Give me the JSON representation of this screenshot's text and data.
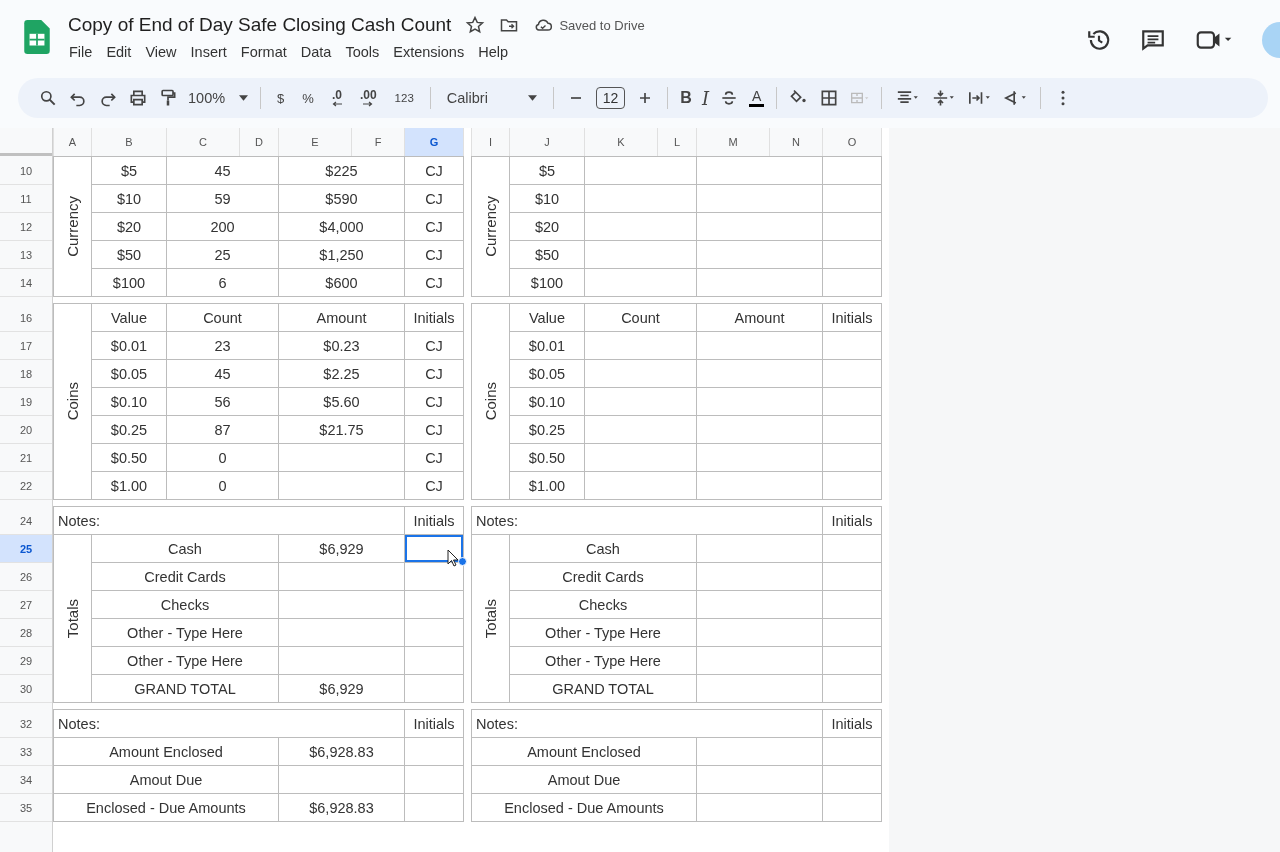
{
  "document": {
    "title": "Copy of End of Day Safe Closing Cash Count",
    "save_status": "Saved to Drive"
  },
  "menu": [
    "File",
    "Edit",
    "View",
    "Insert",
    "Format",
    "Data",
    "Tools",
    "Extensions",
    "Help"
  ],
  "toolbar": {
    "zoom": "100%",
    "currency": "$",
    "percent": "%",
    "decrease_decimals": ".0",
    "increase_decimals": ".00",
    "number_format": "123",
    "font": "Calibri",
    "font_size": "12",
    "bold": "B",
    "italic": "I",
    "text_color": "A"
  },
  "column_headers": [
    [
      {
        "label": "A",
        "selected": false
      },
      {
        "label": "B",
        "selected": false
      },
      {
        "label": "C",
        "selected": false
      },
      {
        "label": "D",
        "selected": false
      },
      {
        "label": "E",
        "selected": false
      },
      {
        "label": "F",
        "selected": false
      },
      {
        "label": "G",
        "selected": true
      }
    ],
    [
      {
        "label": "I",
        "selected": false
      },
      {
        "label": "J",
        "selected": false
      },
      {
        "label": "K",
        "selected": false
      },
      {
        "label": "L",
        "selected": false
      },
      {
        "label": "M",
        "selected": false
      },
      {
        "label": "N",
        "selected": false
      },
      {
        "label": "O",
        "selected": false
      }
    ]
  ],
  "row_groups": [
    [
      {
        "number": "10",
        "selected": false
      },
      {
        "number": "11",
        "selected": false
      },
      {
        "number": "12",
        "selected": false
      },
      {
        "number": "13",
        "selected": false
      },
      {
        "number": "14",
        "selected": false
      }
    ],
    [
      {
        "number": "16",
        "selected": false
      },
      {
        "number": "17",
        "selected": false
      },
      {
        "number": "18",
        "selected": false
      },
      {
        "number": "19",
        "selected": false
      },
      {
        "number": "20",
        "selected": false
      },
      {
        "number": "21",
        "selected": false
      },
      {
        "number": "22",
        "selected": false
      }
    ],
    [
      {
        "number": "24",
        "selected": false
      },
      {
        "number": "25",
        "selected": true
      },
      {
        "number": "26",
        "selected": false
      },
      {
        "number": "27",
        "selected": false
      },
      {
        "number": "28",
        "selected": false
      },
      {
        "number": "29",
        "selected": false
      },
      {
        "number": "30",
        "selected": false
      }
    ],
    [
      {
        "number": "32",
        "selected": false
      },
      {
        "number": "33",
        "selected": false
      },
      {
        "number": "34",
        "selected": false
      },
      {
        "number": "35",
        "selected": false
      }
    ]
  ],
  "panels": [
    {
      "blocks": [
        {
          "kind": "currency",
          "side_label": "Currency",
          "rows": [
            {
              "value": "$5",
              "count": "45",
              "amount": "$225",
              "initials": "CJ"
            },
            {
              "value": "$10",
              "count": "59",
              "amount": "$590",
              "initials": "CJ"
            },
            {
              "value": "$20",
              "count": "200",
              "amount": "$4,000",
              "initials": "CJ"
            },
            {
              "value": "$50",
              "count": "25",
              "amount": "$1,250",
              "initials": "CJ"
            },
            {
              "value": "$100",
              "count": "6",
              "amount": "$600",
              "initials": "CJ"
            }
          ]
        },
        {
          "kind": "coins",
          "side_label": "Coins",
          "header": {
            "value": "Value",
            "count": "Count",
            "amount": "Amount",
            "initials": "Initials"
          },
          "rows": [
            {
              "value": "$0.01",
              "count": "23",
              "amount": "$0.23",
              "initials": "CJ"
            },
            {
              "value": "$0.05",
              "count": "45",
              "amount": "$2.25",
              "initials": "CJ"
            },
            {
              "value": "$0.10",
              "count": "56",
              "amount": "$5.60",
              "initials": "CJ"
            },
            {
              "value": "$0.25",
              "count": "87",
              "amount": "$21.75",
              "initials": "CJ"
            },
            {
              "value": "$0.50",
              "count": "0",
              "initials": "CJ"
            },
            {
              "value": "$1.00",
              "count": "0",
              "initials": "CJ"
            }
          ]
        },
        {
          "kind": "totals",
          "notes": "Notes:",
          "initials": "Initials",
          "side_label": "Totals",
          "rows": [
            {
              "label": "Cash",
              "amount": "$6,929",
              "selected": true
            },
            {
              "label": "Credit Cards",
              "selected": false
            },
            {
              "label": "Checks",
              "selected": false
            },
            {
              "label": "Other - Type Here",
              "selected": false
            },
            {
              "label": "Other - Type Here",
              "selected": false
            },
            {
              "label": "GRAND TOTAL",
              "amount": "$6,929",
              "selected": false
            }
          ]
        },
        {
          "kind": "enclosed",
          "notes": "Notes:",
          "initials": "Initials",
          "rows": [
            {
              "label": "Amount Enclosed",
              "amount": "$6,928.83"
            },
            {
              "label": "Amout Due"
            },
            {
              "label": "Enclosed - Due Amounts",
              "amount": "$6,928.83"
            }
          ]
        }
      ]
    },
    {
      "blocks": [
        {
          "kind": "currency",
          "side_label": "Currency",
          "rows": [
            {
              "value": "$5"
            },
            {
              "value": "$10"
            },
            {
              "value": "$20"
            },
            {
              "value": "$50"
            },
            {
              "value": "$100"
            }
          ]
        },
        {
          "kind": "coins",
          "side_label": "Coins",
          "header": {
            "value": "Value",
            "count": "Count",
            "amount": "Amount",
            "initials": "Initials"
          },
          "rows": [
            {
              "value": "$0.01"
            },
            {
              "value": "$0.05"
            },
            {
              "value": "$0.10"
            },
            {
              "value": "$0.25"
            },
            {
              "value": "$0.50"
            },
            {
              "value": "$1.00"
            }
          ]
        },
        {
          "kind": "totals",
          "notes": "Notes:",
          "initials": "Initials",
          "side_label": "Totals",
          "rows": [
            {
              "label": "Cash",
              "selected": false
            },
            {
              "label": "Credit Cards",
              "selected": false
            },
            {
              "label": "Checks",
              "selected": false
            },
            {
              "label": "Other - Type Here",
              "selected": false
            },
            {
              "label": "Other - Type Here",
              "selected": false
            },
            {
              "label": "GRAND TOTAL",
              "selected": false
            }
          ]
        },
        {
          "kind": "enclosed",
          "notes": "Notes:",
          "initials": "Initials",
          "rows": [
            {
              "label": "Amount Enclosed"
            },
            {
              "label": "Amout Due"
            },
            {
              "label": "Enclosed - Due Amounts"
            }
          ]
        }
      ]
    }
  ]
}
